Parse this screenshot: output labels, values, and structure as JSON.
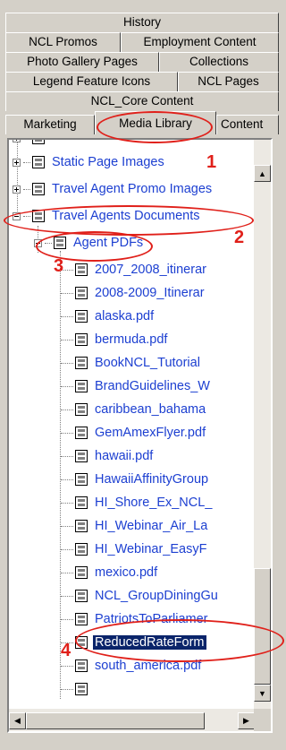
{
  "tabs": {
    "row1": [
      "History"
    ],
    "row2": [
      "NCL Promos",
      "Employment Content"
    ],
    "row3": [
      "Photo Gallery Pages",
      "Collections"
    ],
    "row4": [
      "Legend Feature Icons",
      "NCL Pages"
    ],
    "row5": [
      "NCL_Core Content"
    ],
    "row6": [
      "Marketing",
      "Media Library",
      "Content"
    ],
    "active": "Media Library"
  },
  "tree": {
    "items": [
      {
        "label": "Static Page Images",
        "expander": "plus",
        "level": 0
      },
      {
        "label": "Travel Agent Promo Images",
        "expander": "plus",
        "level": 0
      },
      {
        "label": "Travel Agents Documents",
        "expander": "minus",
        "level": 0
      },
      {
        "label": "Agent PDFs",
        "expander": "minus",
        "level": 1
      },
      {
        "label": "2007_2008_itinerar",
        "level": 2
      },
      {
        "label": "2008-2009_Itinerar",
        "level": 2
      },
      {
        "label": "alaska.pdf",
        "level": 2
      },
      {
        "label": "bermuda.pdf",
        "level": 2
      },
      {
        "label": "BookNCL_Tutorial",
        "level": 2
      },
      {
        "label": "BrandGuidelines_W",
        "level": 2
      },
      {
        "label": "caribbean_bahama",
        "level": 2
      },
      {
        "label": "GemAmexFlyer.pdf",
        "level": 2
      },
      {
        "label": "hawaii.pdf",
        "level": 2
      },
      {
        "label": "HawaiiAffinityGroup",
        "level": 2
      },
      {
        "label": "HI_Shore_Ex_NCL_",
        "level": 2
      },
      {
        "label": "HI_Webinar_Air_La",
        "level": 2
      },
      {
        "label": "HI_Webinar_EasyF",
        "level": 2
      },
      {
        "label": "mexico.pdf",
        "level": 2
      },
      {
        "label": "NCL_GroupDiningGu",
        "level": 2
      },
      {
        "label": "PatriotsToParliamer",
        "level": 2
      },
      {
        "label": "ReducedRateForm",
        "level": 2,
        "selected": true
      },
      {
        "label": "south_america.pdf",
        "level": 2
      }
    ]
  },
  "annotations": [
    "1",
    "2",
    "3",
    "4"
  ],
  "colors": {
    "annotation": "#e0201a",
    "link": "#1c3fd1",
    "selection": "#0a246a"
  },
  "icons": {
    "node": "document-folder-icon",
    "scroll_up": "arrow-up-icon",
    "scroll_down": "arrow-down-icon",
    "scroll_left": "arrow-left-icon",
    "scroll_right": "arrow-right-icon"
  }
}
